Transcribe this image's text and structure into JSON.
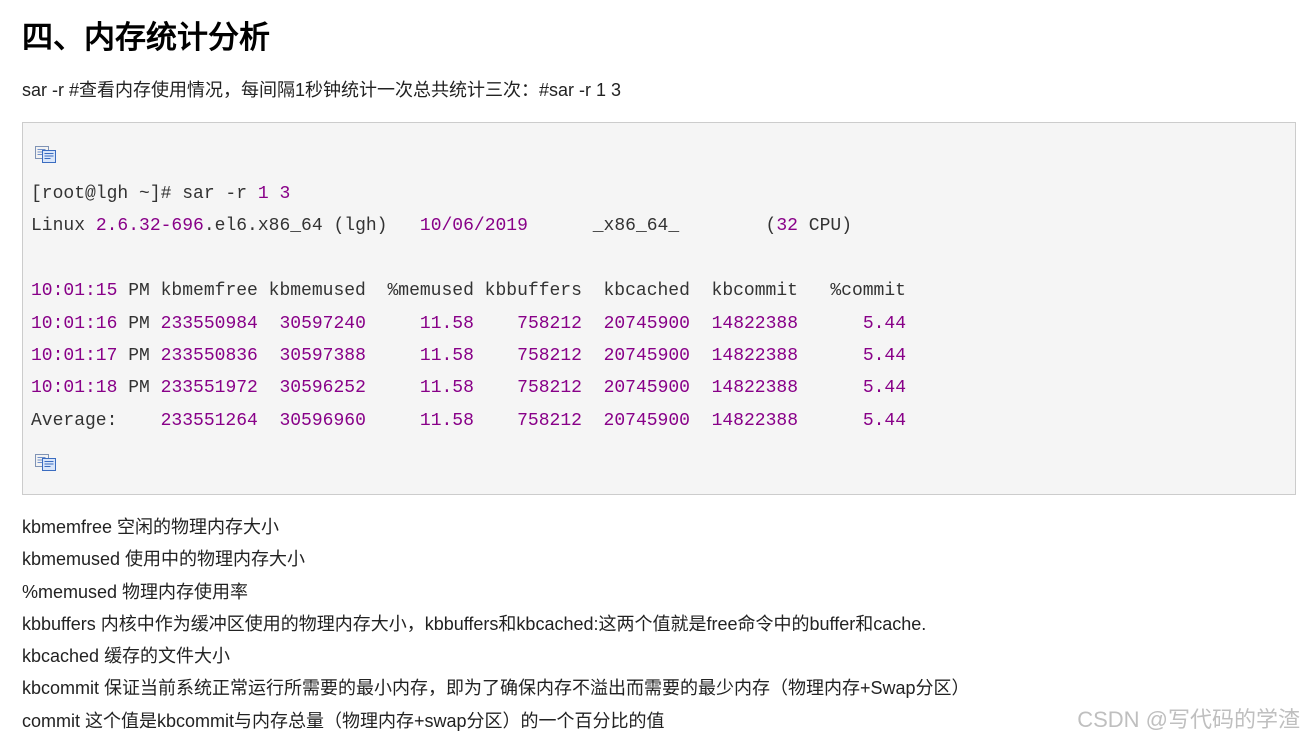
{
  "article": {
    "heading": "四、内存统计分析",
    "intro": "sar -r #查看内存使用情况，每间隔1秒钟统计一次总共统计三次：#sar -r 1 3"
  },
  "icons": {
    "copy": "copy-icon"
  },
  "code_block": {
    "lines": [
      {
        "segments": [
          {
            "text": "[root@lgh ~]# sar -r "
          },
          {
            "text": "1",
            "number": true
          },
          {
            "text": " "
          },
          {
            "text": "3",
            "number": true
          }
        ]
      },
      {
        "segments": [
          {
            "text": "Linux "
          },
          {
            "text": "2.6.32-696",
            "number": true
          },
          {
            "text": ".el6.x86_64 (lgh)   "
          },
          {
            "text": "10/06/2019",
            "number": true
          },
          {
            "text": "      _x86_64_        ("
          },
          {
            "text": "32",
            "number": true
          },
          {
            "text": " CPU)"
          }
        ]
      },
      {
        "segments": []
      },
      {
        "segments": [
          {
            "text": "10:01:15",
            "number": true
          },
          {
            "text": " PM kbmemfree kbmemused  %memused kbbuffers  kbcached  kbcommit   %commit"
          }
        ]
      },
      {
        "segments": [
          {
            "text": "10:01:16",
            "number": true
          },
          {
            "text": " PM "
          },
          {
            "text": "233550984",
            "number": true
          },
          {
            "text": "  "
          },
          {
            "text": "30597240",
            "number": true
          },
          {
            "text": "     "
          },
          {
            "text": "11.58",
            "number": true
          },
          {
            "text": "    "
          },
          {
            "text": "758212",
            "number": true
          },
          {
            "text": "  "
          },
          {
            "text": "20745900",
            "number": true
          },
          {
            "text": "  "
          },
          {
            "text": "14822388",
            "number": true
          },
          {
            "text": "      "
          },
          {
            "text": "5.44",
            "number": true
          }
        ]
      },
      {
        "segments": [
          {
            "text": "10:01:17",
            "number": true
          },
          {
            "text": " PM "
          },
          {
            "text": "233550836",
            "number": true
          },
          {
            "text": "  "
          },
          {
            "text": "30597388",
            "number": true
          },
          {
            "text": "     "
          },
          {
            "text": "11.58",
            "number": true
          },
          {
            "text": "    "
          },
          {
            "text": "758212",
            "number": true
          },
          {
            "text": "  "
          },
          {
            "text": "20745900",
            "number": true
          },
          {
            "text": "  "
          },
          {
            "text": "14822388",
            "number": true
          },
          {
            "text": "      "
          },
          {
            "text": "5.44",
            "number": true
          }
        ]
      },
      {
        "segments": [
          {
            "text": "10:01:18",
            "number": true
          },
          {
            "text": " PM "
          },
          {
            "text": "233551972",
            "number": true
          },
          {
            "text": "  "
          },
          {
            "text": "30596252",
            "number": true
          },
          {
            "text": "     "
          },
          {
            "text": "11.58",
            "number": true
          },
          {
            "text": "    "
          },
          {
            "text": "758212",
            "number": true
          },
          {
            "text": "  "
          },
          {
            "text": "20745900",
            "number": true
          },
          {
            "text": "  "
          },
          {
            "text": "14822388",
            "number": true
          },
          {
            "text": "      "
          },
          {
            "text": "5.44",
            "number": true
          }
        ]
      },
      {
        "segments": [
          {
            "text": "Average:    "
          },
          {
            "text": "233551264",
            "number": true
          },
          {
            "text": "  "
          },
          {
            "text": "30596960",
            "number": true
          },
          {
            "text": "     "
          },
          {
            "text": "11.58",
            "number": true
          },
          {
            "text": "    "
          },
          {
            "text": "758212",
            "number": true
          },
          {
            "text": "  "
          },
          {
            "text": "20745900",
            "number": true
          },
          {
            "text": "  "
          },
          {
            "text": "14822388",
            "number": true
          },
          {
            "text": "      "
          },
          {
            "text": "5.44",
            "number": true
          }
        ]
      }
    ]
  },
  "definitions": [
    {
      "term": "kbmemfree",
      "desc": "空闲的物理内存大小"
    },
    {
      "term": "kbmemused",
      "desc": "使用中的物理内存大小"
    },
    {
      "term": "%memused",
      "desc": "物理内存使用率"
    },
    {
      "term": "kbbuffers",
      "desc": "内核中作为缓冲区使用的物理内存大小，kbbuffers和kbcached:这两个值就是free命令中的buffer和cache."
    },
    {
      "term": "kbcached",
      "desc": "缓存的文件大小"
    },
    {
      "term": "kbcommit",
      "desc": "保证当前系统正常运行所需要的最小内存，即为了确保内存不溢出而需要的最少内存（物理内存+Swap分区）"
    },
    {
      "term": "commit",
      "desc": "这个值是kbcommit与内存总量（物理内存+swap分区）的一个百分比的值"
    }
  ],
  "watermark": "CSDN @写代码的学渣",
  "colors": {
    "heading": "#000000",
    "text": "#222222",
    "code_text": "#333333",
    "code_number": "#880088",
    "code_background": "#f5f5f5",
    "code_border": "#cccccc",
    "watermark": "#bfbfbf"
  }
}
